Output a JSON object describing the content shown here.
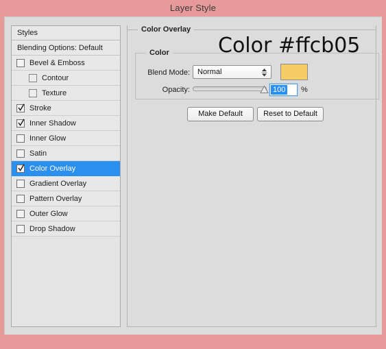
{
  "window": {
    "title": "Layer Style",
    "frame_color": "#e79a9a",
    "dialog_bg": "#dcdcdc"
  },
  "annotation": {
    "watermark_text": "Color #ffcb05"
  },
  "styles_panel": {
    "header_label": "Styles",
    "blending_options_label": "Blending Options: Default",
    "effects": [
      {
        "label": "Bevel & Emboss",
        "checked": false,
        "indent": false,
        "selected": false
      },
      {
        "label": "Contour",
        "checked": false,
        "indent": true,
        "selected": false
      },
      {
        "label": "Texture",
        "checked": false,
        "indent": true,
        "selected": false
      },
      {
        "label": "Stroke",
        "checked": true,
        "indent": false,
        "selected": false
      },
      {
        "label": "Inner Shadow",
        "checked": true,
        "indent": false,
        "selected": false
      },
      {
        "label": "Inner Glow",
        "checked": false,
        "indent": false,
        "selected": false
      },
      {
        "label": "Satin",
        "checked": false,
        "indent": false,
        "selected": false
      },
      {
        "label": "Color Overlay",
        "checked": true,
        "indent": false,
        "selected": true
      },
      {
        "label": "Gradient Overlay",
        "checked": false,
        "indent": false,
        "selected": false
      },
      {
        "label": "Pattern Overlay",
        "checked": false,
        "indent": false,
        "selected": false
      },
      {
        "label": "Outer Glow",
        "checked": false,
        "indent": false,
        "selected": false
      },
      {
        "label": "Drop Shadow",
        "checked": false,
        "indent": false,
        "selected": false
      }
    ],
    "selection_color": "#2a8fef"
  },
  "color_overlay": {
    "group_title": "Color Overlay",
    "inner_group_title": "Color",
    "blend_mode_label": "Blend Mode:",
    "blend_mode_value": "Normal",
    "swatch_color": "#f5cc66",
    "opacity_label": "Opacity:",
    "opacity_value": "100",
    "opacity_unit": "%",
    "make_default_label": "Make Default",
    "reset_default_label": "Reset to Default"
  }
}
